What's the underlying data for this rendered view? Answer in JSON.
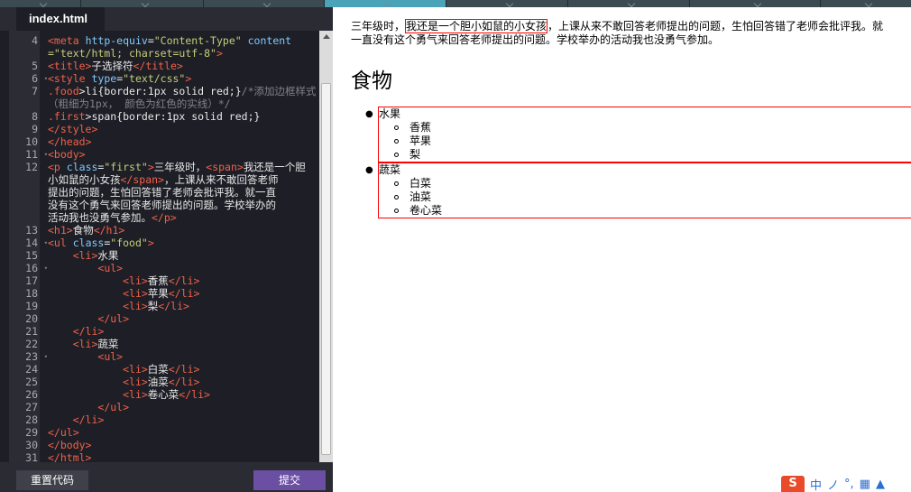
{
  "editor": {
    "tab_label": "index.html",
    "lines": [
      {
        "n": "4",
        "fold": "",
        "html": "<span class=\"t\">&lt;meta</span> <span class=\"a\">http-equiv</span>=<span class=\"s\">\"Content-Type\"</span> <span class=\"a\">content</span>"
      },
      {
        "n": "",
        "fold": "",
        "html": "<span class=\"s\">=\"text/html; charset=utf-8\"</span><span class=\"t\">&gt;</span>"
      },
      {
        "n": "5",
        "fold": "",
        "html": "<span class=\"t\">&lt;title&gt;</span>子选择符<span class=\"t\">&lt;/title&gt;</span>"
      },
      {
        "n": "6",
        "fold": "▾",
        "html": "<span class=\"t\">&lt;style</span> <span class=\"a\">type</span>=<span class=\"s\">\"text/css\"</span><span class=\"t\">&gt;</span>"
      },
      {
        "n": "7",
        "fold": "",
        "html": "<span class=\"k\">.food</span>&gt;li{<span class=\"p\">border</span>:1px solid red;}<span class=\"c\">/*添加边框样式</span>"
      },
      {
        "n": "",
        "fold": "",
        "html": "<span class=\"c\">（粗细为1px， 颜色为红色的实线）*/</span>"
      },
      {
        "n": "8",
        "fold": "",
        "html": "<span class=\"k\">.first</span>&gt;span{<span class=\"p\">border</span>:1px solid red;}"
      },
      {
        "n": "9",
        "fold": "",
        "html": "<span class=\"t\">&lt;/style&gt;</span>"
      },
      {
        "n": "10",
        "fold": "",
        "html": "<span class=\"t\">&lt;/head&gt;</span>"
      },
      {
        "n": "11",
        "fold": "▾",
        "html": "<span class=\"t\">&lt;body&gt;</span>"
      },
      {
        "n": "12",
        "fold": "",
        "html": "<span class=\"t\">&lt;p</span> <span class=\"a\">class</span>=<span class=\"s\">\"first\"</span><span class=\"t\">&gt;</span>三年级时，<span class=\"t\">&lt;span&gt;</span>我还是一个胆"
      },
      {
        "n": "",
        "fold": "",
        "html": "小如鼠的小女孩<span class=\"t\">&lt;/span&gt;</span>，上课从来不敢回答老师"
      },
      {
        "n": "",
        "fold": "",
        "html": "提出的问题，生怕回答错了老师会批评我。就一直"
      },
      {
        "n": "",
        "fold": "",
        "html": "没有这个勇气来回答老师提出的问题。学校举办的"
      },
      {
        "n": "",
        "fold": "",
        "html": "活动我也没勇气参加。<span class=\"t\">&lt;/p&gt;</span>"
      },
      {
        "n": "13",
        "fold": "",
        "html": "<span class=\"t\">&lt;h1&gt;</span>食物<span class=\"t\">&lt;/h1&gt;</span>"
      },
      {
        "n": "14",
        "fold": "▾",
        "html": "<span class=\"t\">&lt;ul</span> <span class=\"a\">class</span>=<span class=\"s\">\"food\"</span><span class=\"t\">&gt;</span>"
      },
      {
        "n": "15",
        "fold": "",
        "html": "    <span class=\"t\">&lt;li&gt;</span>水果"
      },
      {
        "n": "16",
        "fold": "▾",
        "html": "        <span class=\"t\">&lt;ul&gt;</span>"
      },
      {
        "n": "17",
        "fold": "",
        "html": "            <span class=\"t\">&lt;li&gt;</span>香蕉<span class=\"t\">&lt;/li&gt;</span>"
      },
      {
        "n": "18",
        "fold": "",
        "html": "            <span class=\"t\">&lt;li&gt;</span>苹果<span class=\"t\">&lt;/li&gt;</span>"
      },
      {
        "n": "19",
        "fold": "",
        "html": "            <span class=\"t\">&lt;li&gt;</span>梨<span class=\"t\">&lt;/li&gt;</span>"
      },
      {
        "n": "20",
        "fold": "",
        "html": "        <span class=\"t\">&lt;/ul&gt;</span>"
      },
      {
        "n": "21",
        "fold": "",
        "html": "    <span class=\"t\">&lt;/li&gt;</span>"
      },
      {
        "n": "22",
        "fold": "",
        "html": "    <span class=\"t\">&lt;li&gt;</span>蔬菜"
      },
      {
        "n": "23",
        "fold": "▾",
        "html": "        <span class=\"t\">&lt;ul&gt;</span>"
      },
      {
        "n": "24",
        "fold": "",
        "html": "            <span class=\"t\">&lt;li&gt;</span>白菜<span class=\"t\">&lt;/li&gt;</span>"
      },
      {
        "n": "25",
        "fold": "",
        "html": "            <span class=\"t\">&lt;li&gt;</span>油菜<span class=\"t\">&lt;/li&gt;</span>"
      },
      {
        "n": "26",
        "fold": "",
        "html": "            <span class=\"t\">&lt;li&gt;</span>卷心菜<span class=\"t\">&lt;/li&gt;</span>"
      },
      {
        "n": "27",
        "fold": "",
        "html": "        <span class=\"t\">&lt;/ul&gt;</span>"
      },
      {
        "n": "28",
        "fold": "",
        "html": "    <span class=\"t\">&lt;/li&gt;</span>"
      },
      {
        "n": "29",
        "fold": "",
        "html": "<span class=\"t\">&lt;/ul&gt;</span>"
      },
      {
        "n": "30",
        "fold": "",
        "html": "<span class=\"t\">&lt;/body&gt;</span>"
      },
      {
        "n": "31",
        "fold": "",
        "html": "<span class=\"t\">&lt;/html&gt;</span>"
      }
    ],
    "reset_label": "重置代码",
    "submit_label": "提交"
  },
  "preview": {
    "para_before": "三年级时，",
    "para_span": "我还是一个胆小如鼠的小女孩",
    "para_after_line1": "，上课从来不敢回答老师提出的问题，生怕回答错了老师会批评我。就",
    "para_line2": "一直没有这个勇气来回答老师提出的问题。学校举办的活动我也没勇气参加。",
    "heading": "食物",
    "groups": [
      {
        "label": "水果",
        "items": [
          "香蕉",
          "苹果",
          "梨"
        ]
      },
      {
        "label": "蔬菜",
        "items": [
          "白菜",
          "油菜",
          "卷心菜"
        ]
      }
    ]
  },
  "tray": {
    "logo": "S",
    "icons": [
      "中",
      "ノ",
      "°,",
      "▦",
      "▲"
    ]
  },
  "colors": {
    "editor_bg": "#1e1f26",
    "tag": "#f0614a",
    "attr": "#7fc9ff",
    "string": "#c6cc7a",
    "submit": "#6a4fa3",
    "border_red": "#ff0000"
  }
}
